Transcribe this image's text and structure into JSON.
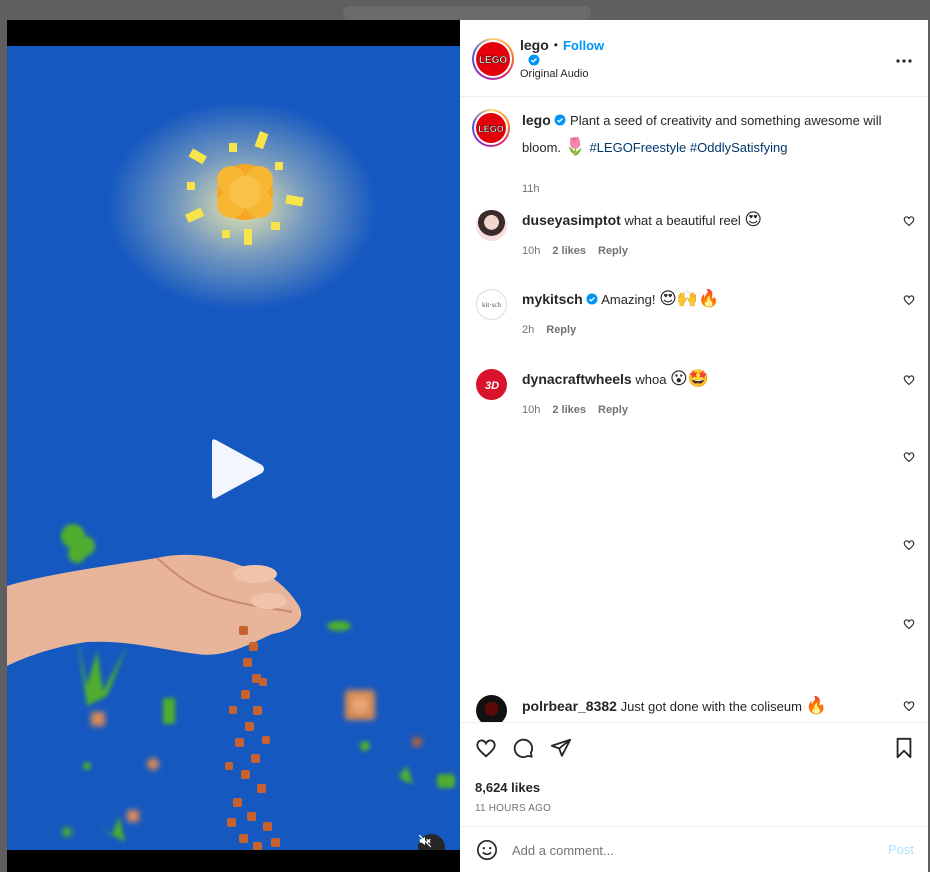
{
  "post": {
    "username": "lego",
    "follow_label": "Follow",
    "separator": "•",
    "audio": "Original Audio",
    "caption": {
      "username": "lego",
      "text": "Plant a seed of creativity and something awesome will bloom.",
      "emoji": "🌷",
      "hashtags": [
        "#LEGOFreestyle",
        "#OddlySatisfying"
      ],
      "time": "11h"
    },
    "logo_text": "LEGO"
  },
  "comments": [
    {
      "username": "duseyasimptot",
      "text": "what a beautiful reel",
      "emoji": "😍",
      "time": "10h",
      "likes": "2 likes",
      "reply": "Reply",
      "avatar": "photo-avatar"
    },
    {
      "username": "mykitsch",
      "text": "Amazing!",
      "emoji": "😍🙌🔥",
      "time": "2h",
      "likes": "",
      "reply": "Reply",
      "avatar": "kitsch-avatar",
      "avatar_text": "kit·sch"
    },
    {
      "username": "dynacraftwheels",
      "text": "whoa",
      "emoji": "😮🤩",
      "time": "10h",
      "likes": "2 likes",
      "reply": "Reply",
      "avatar": "3d-logo-avatar"
    },
    {
      "username": "polrbear_8382",
      "text": "Just got done with the coliseum",
      "emoji": "🔥",
      "avatar": "dark-avatar"
    }
  ],
  "actions": {
    "likes": "8,624 likes",
    "timestamp": "11 HOURS AGO"
  },
  "add_comment": {
    "placeholder": "Add a comment...",
    "post_label": "Post"
  },
  "colors": {
    "accent": "#0095f6",
    "video_blue": "#1558c0",
    "lego_red": "#e3000b",
    "hashtag": "#00376b"
  },
  "icons": [
    "more-icon",
    "verified-icon",
    "heart-icon",
    "comment-icon",
    "share-icon",
    "save-icon",
    "emoji-icon",
    "play-icon",
    "mute-icon"
  ]
}
